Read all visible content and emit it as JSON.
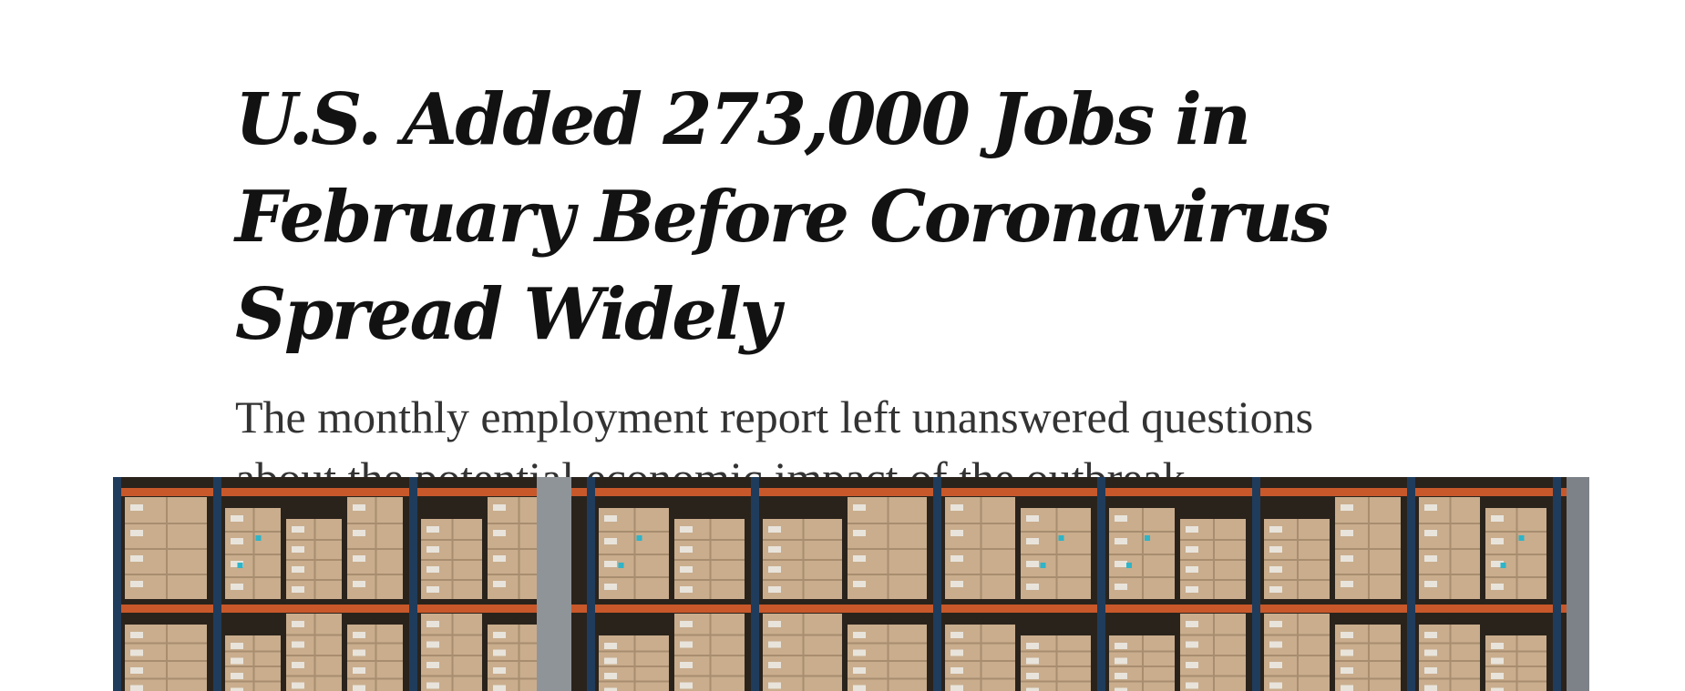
{
  "article": {
    "headline": "U.S. Added 273,000 Jobs in February Before Coronavirus Spread Widely",
    "summary": "The monthly employment report left unanswered questions about the potential economic impact of the outbreak."
  },
  "lead_image": {
    "description_icon": "warehouse-photo",
    "colors": {
      "beam": "#c8582a",
      "upright": "#1f3c5c",
      "box": "#c9ad8d",
      "box_shadow": "#a88d6f",
      "label": "#e8e4dc",
      "tag": "#2fb4c8",
      "background": "#2a231c"
    }
  }
}
